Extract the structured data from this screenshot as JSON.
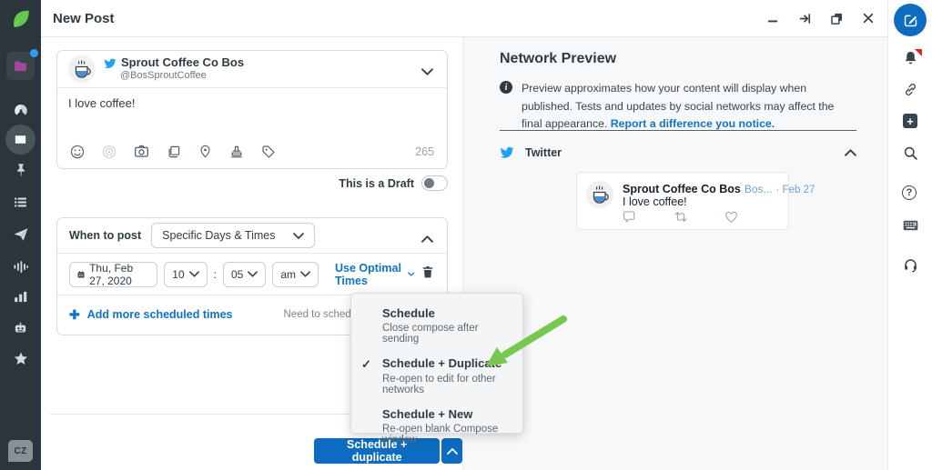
{
  "header": {
    "title": "New Post"
  },
  "left_rail": {
    "avatar_initials": "CZ"
  },
  "compose": {
    "account": {
      "name": "Sprout Coffee Co Bos",
      "handle": "@BosSproutCoffee"
    },
    "message": "I love coffee!",
    "char_count": "265",
    "draft_toggle_label": "This is a Draft",
    "scheduler": {
      "label": "When to post",
      "mode_value": "Specific Days & Times",
      "date_value": "Thu, Feb 27, 2020",
      "hour_value": "10",
      "minute_value": "05",
      "meridiem_value": "am",
      "colon": ":",
      "optimal_link": "Use Optimal Times",
      "add_link": "Add more scheduled times",
      "bulk_hint": "Need to schedule a lot at once?"
    },
    "submit_button": "Schedule + duplicate"
  },
  "schedule_menu": {
    "items": [
      {
        "title": "Schedule",
        "subtitle": "Close compose after sending",
        "check": ""
      },
      {
        "title": "Schedule + Duplicate",
        "subtitle": "Re-open to edit for other networks",
        "check": "✓"
      },
      {
        "title": "Schedule + New",
        "subtitle": "Re-open blank Compose window",
        "check": ""
      }
    ]
  },
  "preview": {
    "title": "Network Preview",
    "disclaimer_text": "Preview approximates how your content will display when published. Tests and updates by social networks may affect the final appearance.",
    "disclaimer_link": "Report a difference you notice.",
    "network_label": "Twitter",
    "tweet": {
      "display_name": "Sprout Coffee Co Bos",
      "handle": "Bos...",
      "timestamp": "· Feb 27",
      "body": "I love coffee!"
    }
  },
  "colors": {
    "accent_blue": "#0d6cc0",
    "link_blue": "#1173c4",
    "sidebar_dark": "#2b363c",
    "twitter_blue": "#1da1f2",
    "arrow_green": "#76c84e",
    "alert_red": "#dd2c1f"
  }
}
